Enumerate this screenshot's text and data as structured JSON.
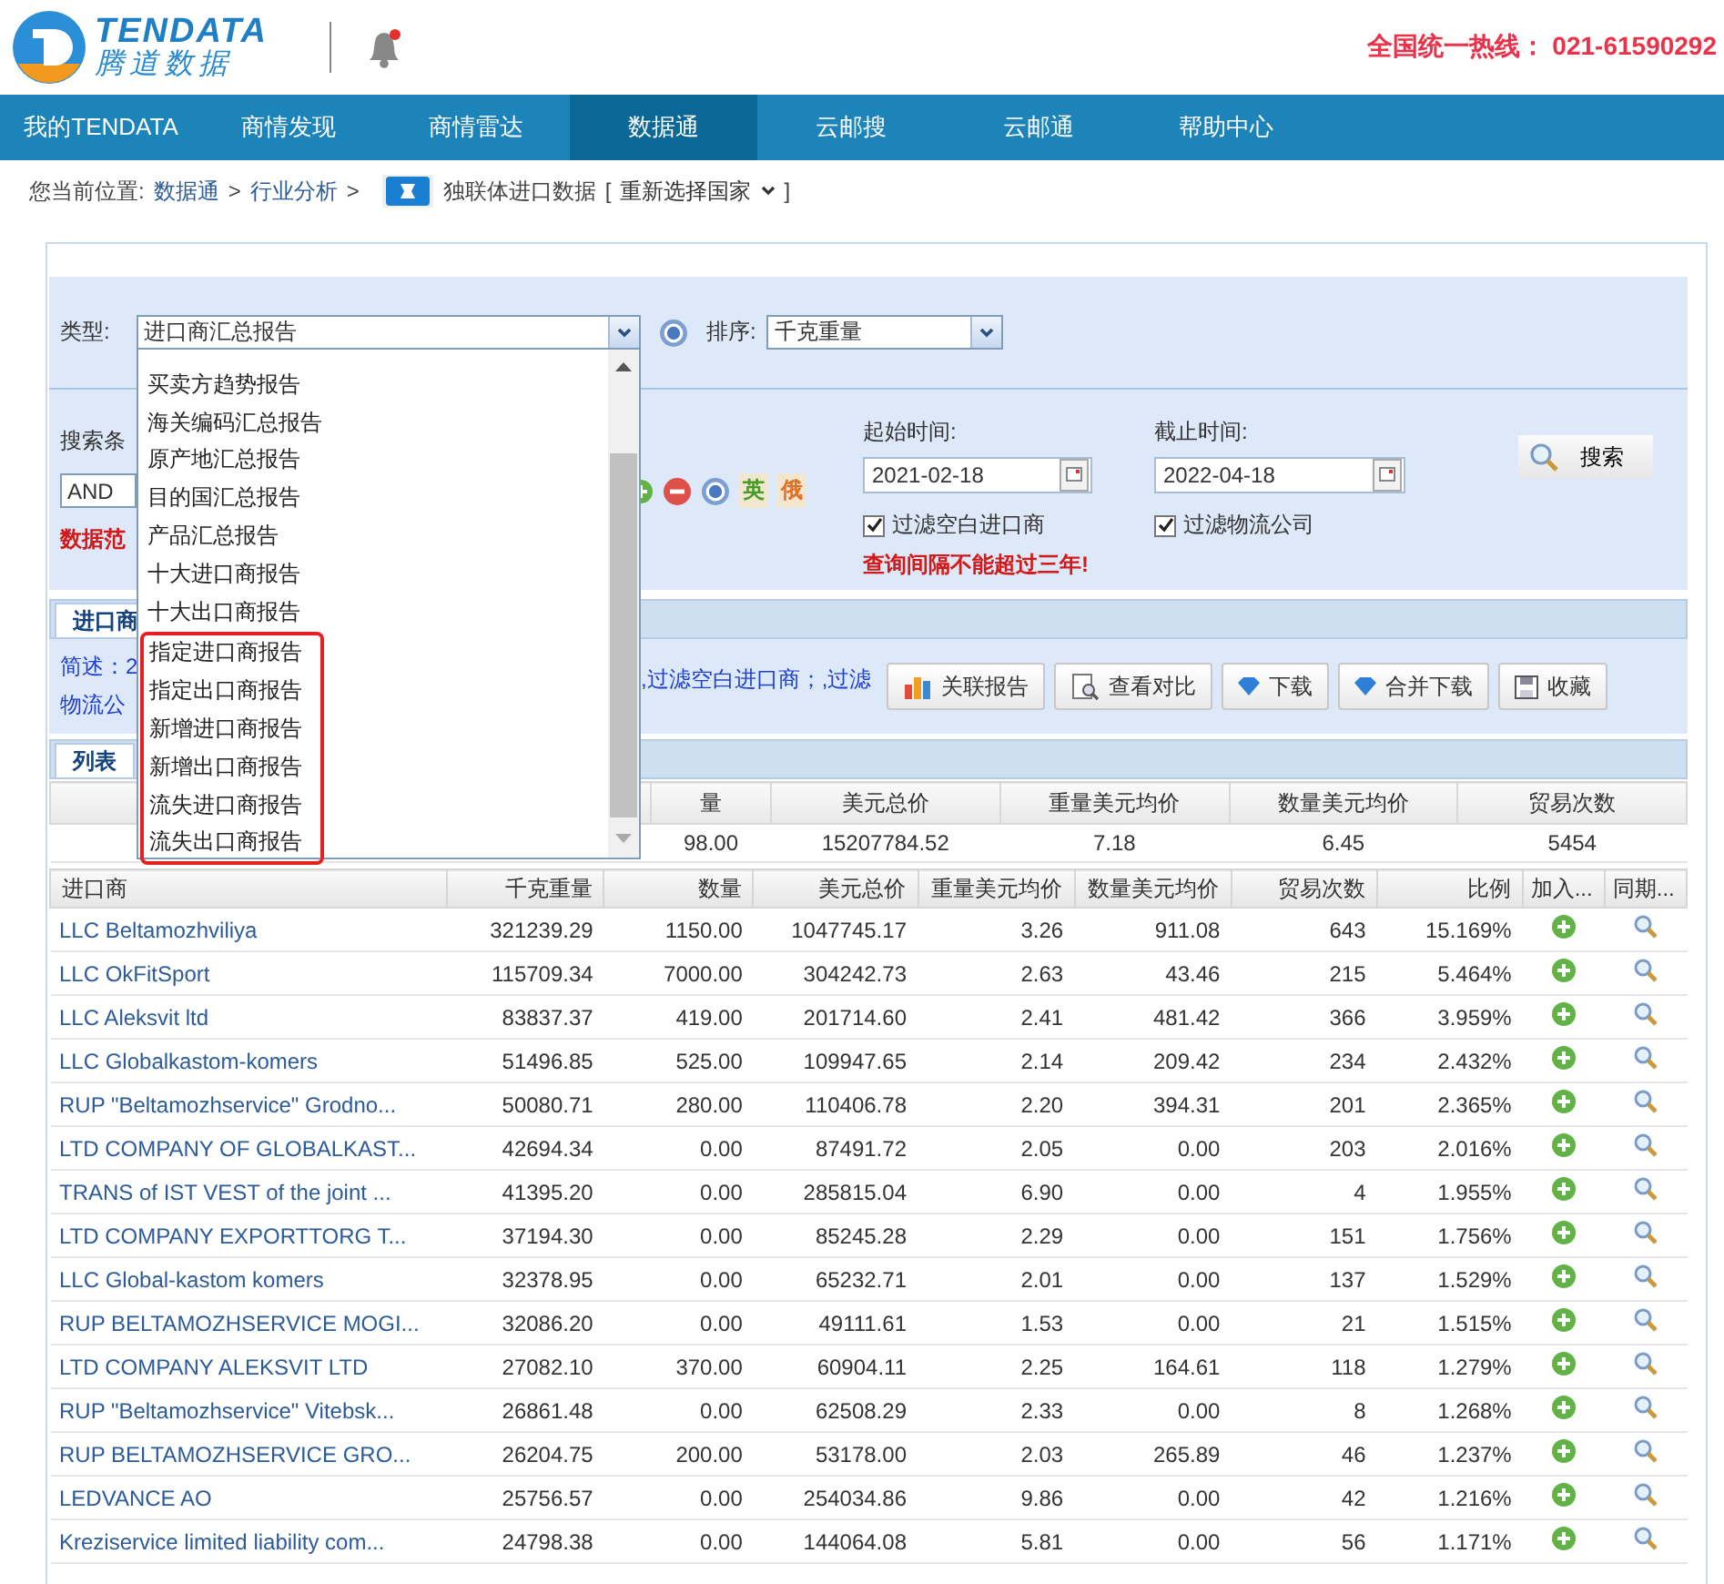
{
  "header": {
    "brand": "TENDATA",
    "brand_cn": "腾道数据",
    "hotline": "全国统一热线： 021-61590292"
  },
  "nav": [
    {
      "label": "我的TENDATA",
      "selected": false
    },
    {
      "label": "商情发现",
      "selected": false
    },
    {
      "label": "商情雷达",
      "selected": false
    },
    {
      "label": "数据通",
      "selected": true
    },
    {
      "label": "云邮搜",
      "selected": false
    },
    {
      "label": "云邮通",
      "selected": false
    },
    {
      "label": "帮助中心",
      "selected": false
    }
  ],
  "breadcrumb": {
    "prefix": "您当前位置:",
    "separator": ">",
    "path": [
      "数据通",
      "行业分析"
    ],
    "dataset": "独联体进口数据",
    "switch_open": "[",
    "switch_label": "重新选择国家",
    "switch_close": "]"
  },
  "form": {
    "type_label": "类型:",
    "type_value": "进口商汇总报告",
    "sort_label": "排序:",
    "sort_value": "千克重量",
    "search_label": "搜索条",
    "logic_value": "AND",
    "lang_buttons": [
      "英",
      "俄"
    ],
    "range_label": "数据范",
    "start_label": "起始时间:",
    "start_value": "2021-02-18",
    "end_label": "截止时间:",
    "end_value": "2022-04-18",
    "filters": [
      {
        "label": "过滤空白进口商",
        "checked": true
      },
      {
        "label": "过滤物流公司",
        "checked": true
      }
    ],
    "warning": "查询间隔不能超过三年!",
    "search_button": "搜索"
  },
  "type_dropdown": {
    "items": [
      {
        "label": "买卖方趋势报告",
        "highlighted": false
      },
      {
        "label": "海关编码汇总报告",
        "highlighted": false
      },
      {
        "label": "原产地汇总报告",
        "highlighted": false
      },
      {
        "label": "目的国汇总报告",
        "highlighted": false
      },
      {
        "label": "产品汇总报告",
        "highlighted": false
      },
      {
        "label": "十大进口商报告",
        "highlighted": false
      },
      {
        "label": "十大出口商报告",
        "highlighted": false
      },
      {
        "label": "指定进口商报告",
        "highlighted": true
      },
      {
        "label": "指定出口商报告",
        "highlighted": true
      },
      {
        "label": "新增进口商报告",
        "highlighted": true
      },
      {
        "label": "新增出口商报告",
        "highlighted": true
      },
      {
        "label": "流失进口商报告",
        "highlighted": true
      },
      {
        "label": "流失出口商报告",
        "highlighted": true
      }
    ]
  },
  "result_tabs": [
    {
      "label": "进口商",
      "selected": true
    }
  ],
  "summary": {
    "lines": [
      "简述：2",
      "物流公"
    ],
    "text": ",过滤空白进口商；,过滤"
  },
  "actions": [
    {
      "label": "关联报告",
      "kind": "related"
    },
    {
      "label": "查看对比",
      "kind": "compare"
    },
    {
      "label": "下载",
      "kind": "download"
    },
    {
      "label": "合并下载",
      "kind": "download"
    },
    {
      "label": "收藏",
      "kind": "save"
    }
  ],
  "view_tabs": [
    {
      "label": "列表",
      "selected": true
    }
  ],
  "totals": {
    "columns": [
      "量",
      "美元总价",
      "重量美元均价",
      "数量美元均价",
      "贸易次数"
    ],
    "values": [
      "98.00",
      "15207784.52",
      "7.18",
      "6.45",
      "5454"
    ]
  },
  "table": {
    "columns": [
      "进口商",
      "千克重量",
      "数量",
      "美元总价",
      "重量美元均价",
      "数量美元均价",
      "贸易次数",
      "比例",
      "加入...",
      "同期..."
    ],
    "rows": [
      {
        "cells": [
          "LLC Beltamozhviliya",
          "321239.29",
          "1150.00",
          "1047745.17",
          "3.26",
          "911.08",
          "643",
          "15.169%"
        ]
      },
      {
        "cells": [
          "LLC OkFitSport",
          "115709.34",
          "7000.00",
          "304242.73",
          "2.63",
          "43.46",
          "215",
          "5.464%"
        ]
      },
      {
        "cells": [
          "LLC Aleksvit ltd",
          "83837.37",
          "419.00",
          "201714.60",
          "2.41",
          "481.42",
          "366",
          "3.959%"
        ]
      },
      {
        "cells": [
          "LLC Globalkastom-komers",
          "51496.85",
          "525.00",
          "109947.65",
          "2.14",
          "209.42",
          "234",
          "2.432%"
        ]
      },
      {
        "cells": [
          "RUP \"Beltamozhservice\" Grodno...",
          "50080.71",
          "280.00",
          "110406.78",
          "2.20",
          "394.31",
          "201",
          "2.365%"
        ]
      },
      {
        "cells": [
          "LTD COMPANY OF GLOBALKAST...",
          "42694.34",
          "0.00",
          "87491.72",
          "2.05",
          "0.00",
          "203",
          "2.016%"
        ]
      },
      {
        "cells": [
          "TRANS of IST VEST of the joint ...",
          "41395.20",
          "0.00",
          "285815.04",
          "6.90",
          "0.00",
          "4",
          "1.955%"
        ]
      },
      {
        "cells": [
          "LTD COMPANY EXPORTTORG T...",
          "37194.30",
          "0.00",
          "85245.28",
          "2.29",
          "0.00",
          "151",
          "1.756%"
        ]
      },
      {
        "cells": [
          "LLC Global-kastom komers",
          "32378.95",
          "0.00",
          "65232.71",
          "2.01",
          "0.00",
          "137",
          "1.529%"
        ]
      },
      {
        "cells": [
          "RUP BELTAMOZHSERVICE MOGI...",
          "32086.20",
          "0.00",
          "49111.61",
          "1.53",
          "0.00",
          "21",
          "1.515%"
        ]
      },
      {
        "cells": [
          "LTD COMPANY ALEKSVIT LTD",
          "27082.10",
          "370.00",
          "60904.11",
          "2.25",
          "164.61",
          "118",
          "1.279%"
        ]
      },
      {
        "cells": [
          "RUP \"Beltamozhservice\" Vitebsk...",
          "26861.48",
          "0.00",
          "62508.29",
          "2.33",
          "0.00",
          "8",
          "1.268%"
        ]
      },
      {
        "cells": [
          "RUP BELTAMOZHSERVICE GRO...",
          "26204.75",
          "200.00",
          "53178.00",
          "2.03",
          "265.89",
          "46",
          "1.237%"
        ]
      },
      {
        "cells": [
          "LEDVANCE AO",
          "25756.57",
          "0.00",
          "254034.86",
          "9.86",
          "0.00",
          "42",
          "1.216%"
        ]
      },
      {
        "cells": [
          "Kreziservice limited liability com...",
          "24798.38",
          "0.00",
          "144064.08",
          "5.81",
          "0.00",
          "56",
          "1.171%"
        ]
      }
    ]
  }
}
